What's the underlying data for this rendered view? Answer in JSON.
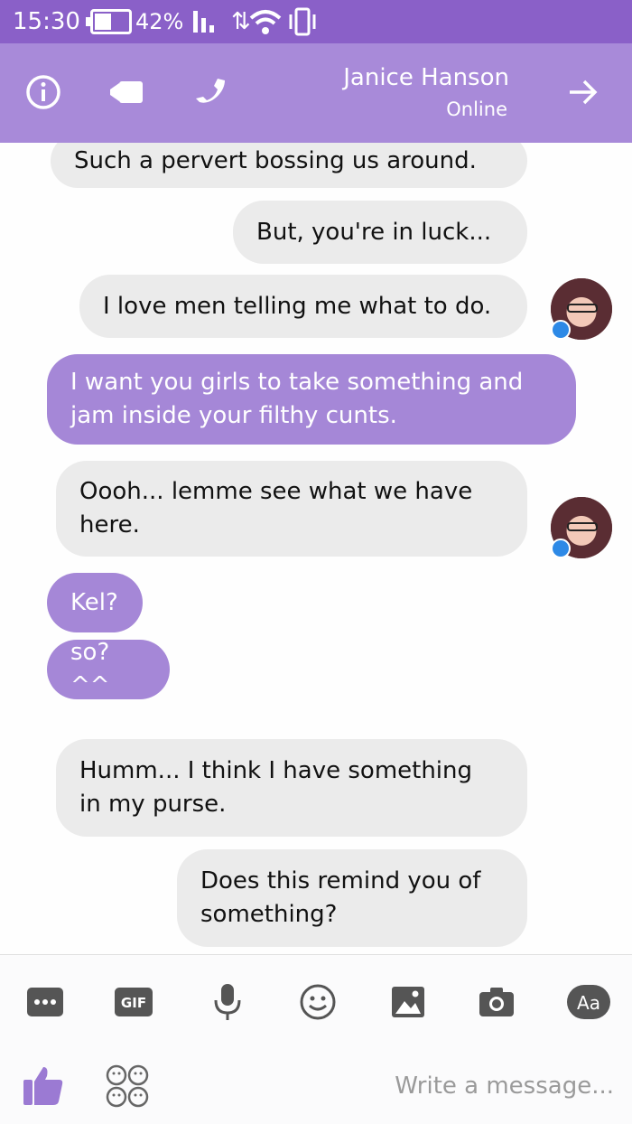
{
  "status_bar": {
    "time": "15:30",
    "battery_percent": "42%",
    "data_indicator": "..",
    "icons": [
      "battery-icon",
      "signal-icon",
      "data-arrows-icon",
      "wifi-icon",
      "vibrate-icon"
    ]
  },
  "app_bar": {
    "contact_name": "Janice Hanson",
    "contact_status": "Online",
    "icons": [
      "info-icon",
      "video-call-icon",
      "phone-icon",
      "forward-arrow-icon"
    ]
  },
  "messages": [
    {
      "direction": "in",
      "text": "Such a pervert bossing us around."
    },
    {
      "direction": "in",
      "text": "But, you're in luck..."
    },
    {
      "direction": "in",
      "text": "I love men telling me what to do.",
      "avatar": true
    },
    {
      "direction": "out",
      "lines": [
        "I want you girls to take something and",
        "jam inside your filthy cunts."
      ]
    },
    {
      "direction": "in",
      "lines": [
        "Oooh... lemme see what we have",
        "here."
      ],
      "avatar": true
    },
    {
      "direction": "out",
      "text": "Kel?"
    },
    {
      "direction": "out",
      "text": "so? ^^"
    },
    {
      "direction": "in",
      "lines": [
        "Humm... I think I have something",
        "in my purse."
      ]
    },
    {
      "direction": "in",
      "lines": [
        "Does this remind you of",
        "something?"
      ]
    }
  ],
  "toolbar": {
    "icons": [
      "more-icon",
      "gif-icon",
      "microphone-icon",
      "emoji-icon",
      "gallery-icon",
      "camera-icon",
      "font-size-icon"
    ],
    "gif_label": "GIF",
    "font_label": "Aa"
  },
  "composer": {
    "placeholder": "Write a message...",
    "icons": [
      "thumbs-up-icon",
      "reactions-grid-icon"
    ]
  },
  "colors": {
    "status_bar": "#8a60c8",
    "app_bar": "#a88ad9",
    "outgoing_bubble": "#a587d7",
    "incoming_bubble": "#ebebeb",
    "accent_badge": "#2d89e6"
  }
}
